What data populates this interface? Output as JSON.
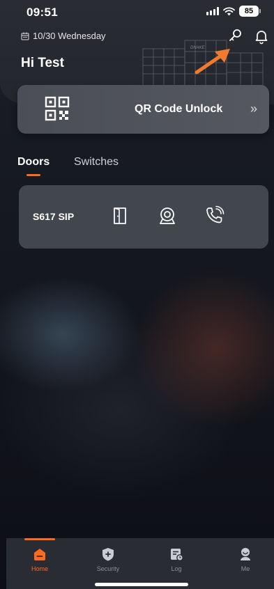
{
  "status_bar": {
    "time": "09:51",
    "battery": "85"
  },
  "header": {
    "date": "10/30 Wednesday",
    "greeting": "Hi Test",
    "brand_logo_text": "DNAKE"
  },
  "qr_card": {
    "label": "QR Code Unlock",
    "chevron": "»"
  },
  "tabs": [
    {
      "label": "Doors",
      "active": true
    },
    {
      "label": "Switches",
      "active": false
    }
  ],
  "devices": [
    {
      "name": "S617 SIP",
      "actions": [
        "door-icon",
        "camera-icon",
        "call-icon"
      ]
    }
  ],
  "bottom_nav": {
    "items": [
      {
        "label": "Home",
        "icon": "home-icon",
        "active": true
      },
      {
        "label": "Security",
        "icon": "shield-icon",
        "active": false
      },
      {
        "label": "Log",
        "icon": "log-icon",
        "active": false
      },
      {
        "label": "Me",
        "icon": "profile-icon",
        "active": false
      }
    ]
  },
  "colors": {
    "accent": "#ff6a1f",
    "background": "#15181f",
    "card": "#50545c"
  }
}
